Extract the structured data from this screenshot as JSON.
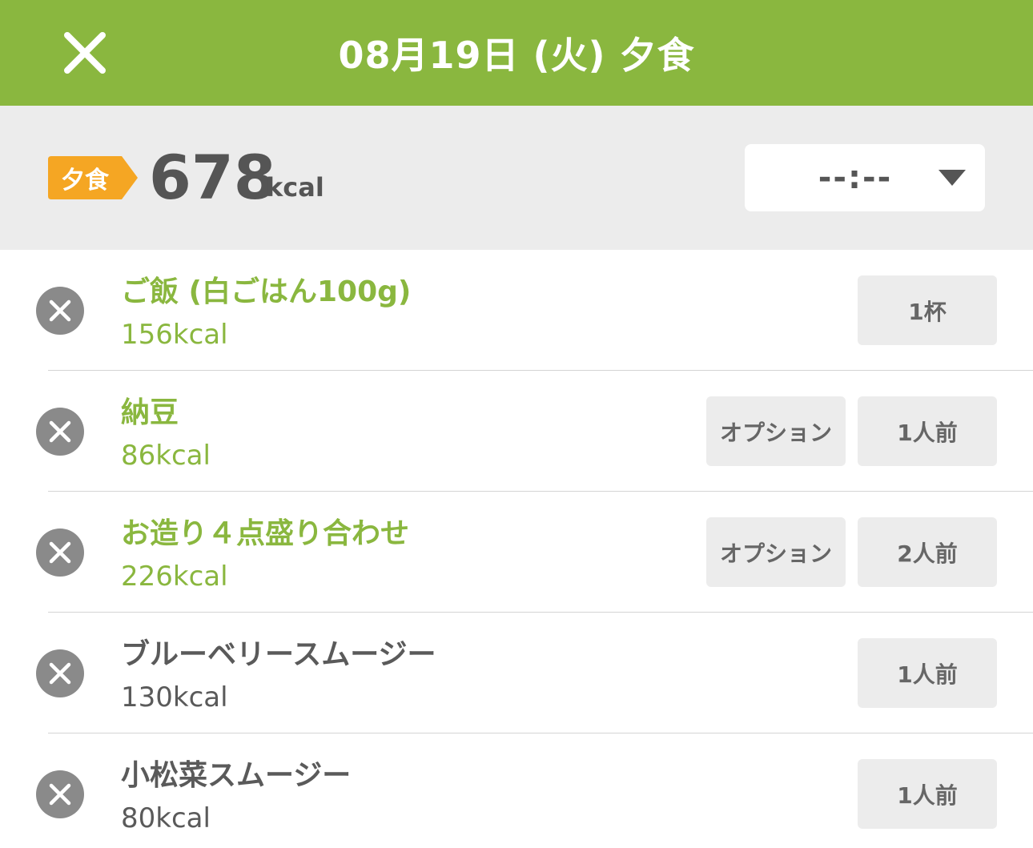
{
  "header": {
    "title": "08月19日 (火) 夕食"
  },
  "summary": {
    "meal_tag": "夕食",
    "total_kcal": "678",
    "unit": "kcal",
    "time_value": "--:--"
  },
  "items": [
    {
      "name": "ご飯 (白ごはん100g)",
      "kcal": "156kcal",
      "qty": "1杯",
      "option": ""
    },
    {
      "name": "納豆",
      "kcal": "86kcal",
      "qty": "1人前",
      "option": "オプション"
    },
    {
      "name": "お造り４点盛り合わせ",
      "kcal": "226kcal",
      "qty": "2人前",
      "option": "オプション"
    },
    {
      "name": "ブルーベリースムージー",
      "kcal": "130kcal",
      "qty": "1人前",
      "option": ""
    },
    {
      "name": "小松菜スムージー",
      "kcal": "80kcal",
      "qty": "1人前",
      "option": ""
    }
  ],
  "colors": {
    "brand_green": "#8ab73f",
    "tag_orange": "#f5a623",
    "summary_bg": "#ececec",
    "delete_gray": "#8a8a8a"
  }
}
